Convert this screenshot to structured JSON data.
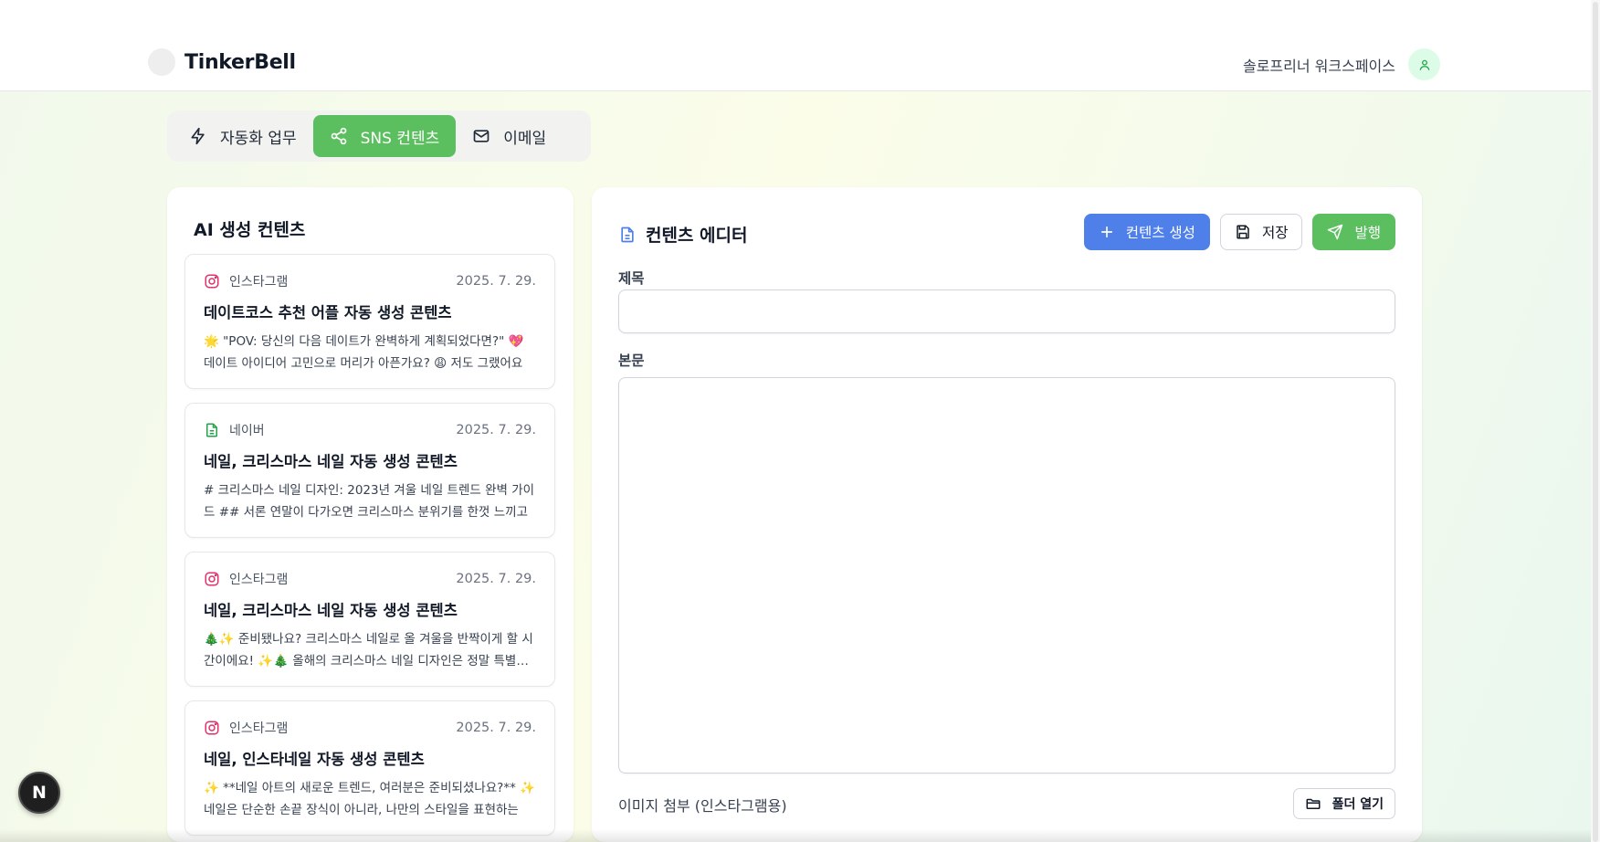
{
  "header": {
    "app_name": "TinkerBell",
    "workspace_name": "솔로프리너 워크스페이스"
  },
  "tabs": [
    {
      "label": "자동화 업무",
      "icon": "lightning-icon",
      "active": false
    },
    {
      "label": "SNS 컨텐츠",
      "icon": "share-icon",
      "active": true
    },
    {
      "label": "이메일",
      "icon": "mail-icon",
      "active": false
    }
  ],
  "content_list": {
    "title": "AI 생성 컨텐츠",
    "items": [
      {
        "platform": "인스타그램",
        "platform_icon": "instagram-icon",
        "date": "2025. 7. 29.",
        "title": "데이트코스 추천 어플 자동 생성 콘텐츠",
        "preview": "🌟 \"POV: 당신의 다음 데이트가 완벽하게 계획되었다면?\" 💖 데이트 아이디어 고민으로 머리가 아픈가요? 😩 저도 그랬어요"
      },
      {
        "platform": "네이버",
        "platform_icon": "document-icon",
        "date": "2025. 7. 29.",
        "title": "네일, 크리스마스 네일 자동 생성 콘텐츠",
        "preview": "# 크리스마스 네일 디자인: 2023년 겨울 네일 트렌드 완벽 가이드 ## 서론 연말이 다가오면 크리스마스 분위기를 한껏 느끼고"
      },
      {
        "platform": "인스타그램",
        "platform_icon": "instagram-icon",
        "date": "2025. 7. 29.",
        "title": "네일, 크리스마스 네일 자동 생성 콘텐츠",
        "preview": "🎄✨ 준비됐나요? 크리스마스 네일로 올 겨울을 반짝이게 할 시간이에요! ✨🎄 올해의 크리스마스 네일 디자인은 정말 특별해요"
      },
      {
        "platform": "인스타그램",
        "platform_icon": "instagram-icon",
        "date": "2025. 7. 29.",
        "title": "네일, 인스타네일 자동 생성 콘텐츠",
        "preview": "✨ **네일 아트의 새로운 트렌드, 여러분은 준비되셨나요?** ✨ 네일은 단순한 손끝 장식이 아니라, 나만의 스타일을 표현하는"
      }
    ]
  },
  "editor": {
    "title": "컨텐츠 에디터",
    "generate_label": "컨텐츠 생성",
    "save_label": "저장",
    "publish_label": "발행",
    "title_field_label": "제목",
    "title_value": "",
    "body_field_label": "본문",
    "body_value": "",
    "attach_label": "이미지 첨부 (인스타그램용)",
    "folder_button_label": "폴더 열기"
  },
  "dev_badge": "N",
  "colors": {
    "accent_green": "#5cbf5f",
    "accent_blue": "#4f7fe9",
    "instagram_pink": "#e1306c",
    "naver_green": "#22a447"
  }
}
